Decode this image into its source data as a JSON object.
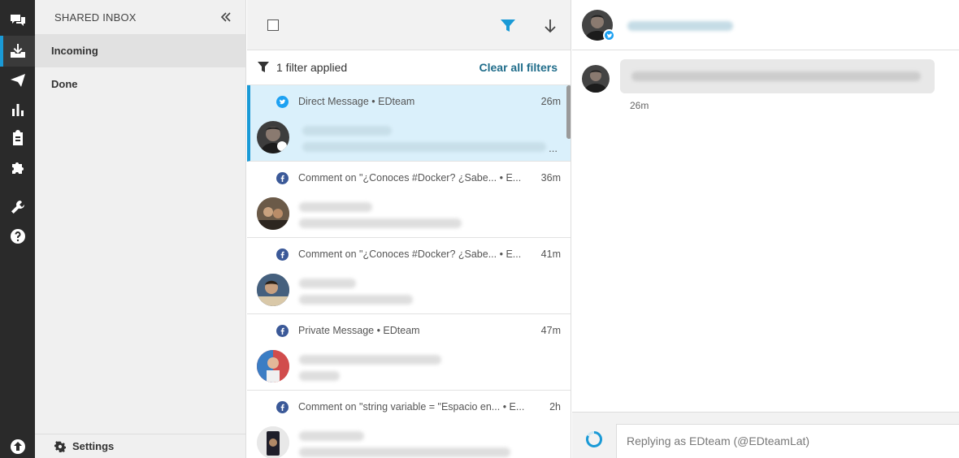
{
  "sidebar": {
    "title": "SHARED INBOX",
    "items": [
      {
        "label": "Incoming",
        "active": true
      },
      {
        "label": "Done",
        "active": false
      }
    ],
    "footer_label": "Settings"
  },
  "list": {
    "filter_text": "1 filter applied",
    "clear_filters_label": "Clear all filters",
    "messages": [
      {
        "network": "twitter",
        "meta": "Direct Message  •  EDteam",
        "time": "26m",
        "selected": true
      },
      {
        "network": "facebook",
        "meta": "Comment on \"¿Conoces #Docker? ¿Sabe...  •  E...",
        "time": "36m",
        "selected": false
      },
      {
        "network": "facebook",
        "meta": "Comment on \"¿Conoces #Docker? ¿Sabe...  •  E...",
        "time": "41m",
        "selected": false
      },
      {
        "network": "facebook",
        "meta": "Private Message  •  EDteam",
        "time": "47m",
        "selected": false
      },
      {
        "network": "facebook",
        "meta": "Comment on \"string variable = \"Espacio en...  •  E...",
        "time": "2h",
        "selected": false
      }
    ],
    "ellipsis": "..."
  },
  "conversation": {
    "message_time": "26m",
    "reply_placeholder": "Replying as EDteam (@EDteamLat)"
  },
  "colors": {
    "accent": "#1a9ad6",
    "rail_bg": "#2a2a2a",
    "selected_bg": "#daf0fb",
    "facebook": "#3b5998",
    "twitter": "#1da1f2",
    "link": "#1f6c8a"
  }
}
